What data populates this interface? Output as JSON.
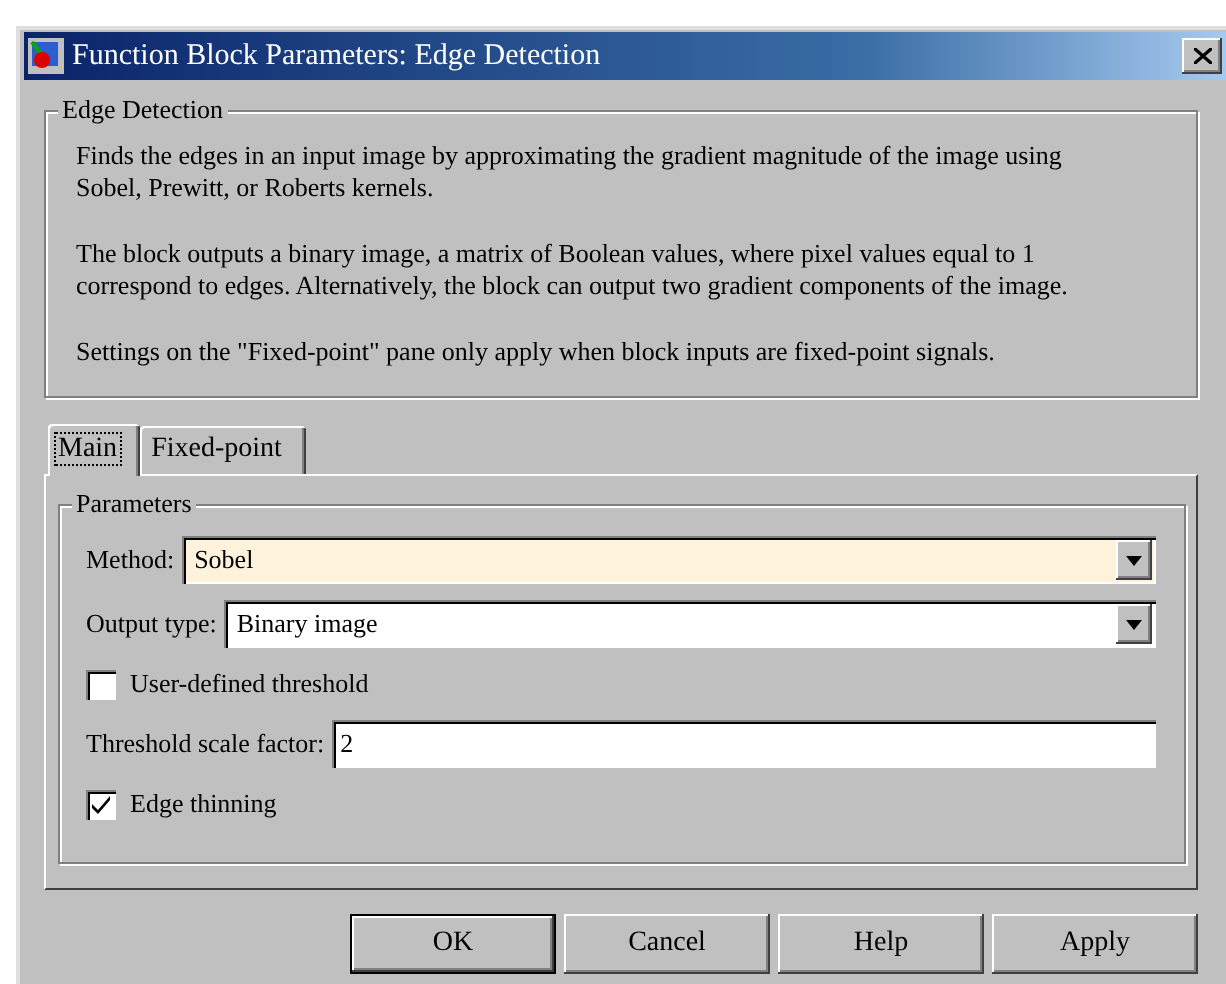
{
  "window": {
    "title": "Function Block Parameters: Edge Detection"
  },
  "description": {
    "title": "Edge Detection",
    "paragraphs": [
      "Finds the edges in an input image by approximating the gradient magnitude of the image using Sobel, Prewitt, or Roberts kernels.",
      "The block outputs a binary image, a matrix of Boolean values, where pixel values equal to 1 correspond to edges.  Alternatively, the block can output two gradient components of the image.",
      "Settings on the \"Fixed-point\" pane only apply when block inputs are fixed-point signals."
    ]
  },
  "tabs": [
    {
      "label": "Main",
      "selected": true
    },
    {
      "label": "Fixed-point",
      "selected": false
    }
  ],
  "parameters": {
    "title": "Parameters",
    "fields": [
      {
        "kind": "dropdown",
        "label": "Method:",
        "value": "Sobel",
        "highlighted": true
      },
      {
        "kind": "dropdown",
        "label": "Output type:",
        "value": "Binary image",
        "highlighted": false
      },
      {
        "kind": "checkbox",
        "label": "User-defined threshold",
        "checked": false
      },
      {
        "kind": "text",
        "label": "Threshold scale factor:",
        "value": "2"
      },
      {
        "kind": "checkbox",
        "label": "Edge thinning",
        "checked": true
      }
    ]
  },
  "buttons": [
    {
      "label": "OK",
      "default": true
    },
    {
      "label": "Cancel",
      "default": false
    },
    {
      "label": "Help",
      "default": false
    },
    {
      "label": "Apply",
      "default": false
    }
  ]
}
